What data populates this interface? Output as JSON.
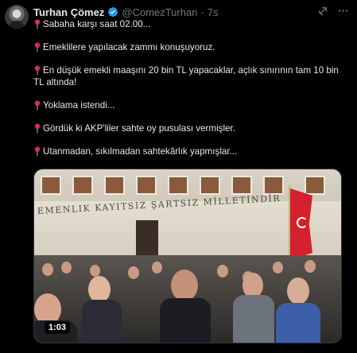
{
  "tweet": {
    "author_name": "Turhan Çömez",
    "handle": "@ComezTurhan",
    "separator": "·",
    "time": "7s",
    "lines": [
      "Sabaha karşı saat 02.00...",
      "Emeklilere yapılacak zammı konuşuyoruz.",
      "En düşük emekli maaşını 20 bin TL yapacaklar, açlık sınırının tam 10 bin TL altında!",
      "Yoklama istendi...",
      "Gördük ki AKP'liler sahte oy pusulası vermişler.",
      "Utanmadan, sıkılmadan sahtekârlık yapmışlar..."
    ],
    "line4_first_row": "En düşük emekli maaşını 20 bin TL yapacaklar, açlık sınırının tam 10 bin",
    "line4_second_row": "TL altında!"
  },
  "media": {
    "inscription": "EMENLIK KAYITSIZ ŞARTSIZ MİLLETİNDİR",
    "duration": "1:03"
  },
  "icons": {
    "verified": "verified-badge-icon",
    "grok": "grok-icon",
    "more": "more-icon",
    "pin": "round-pushpin-icon"
  },
  "colors": {
    "background": "#000000",
    "text": "#e7e9ea",
    "muted": "#71767b",
    "verified": "#1d9bf0",
    "pin": "#e0245e"
  }
}
